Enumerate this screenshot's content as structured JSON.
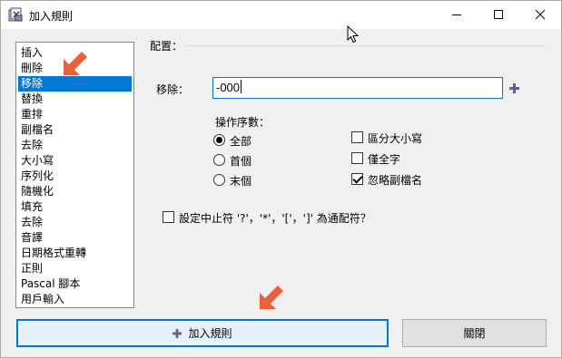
{
  "window": {
    "title": "加入規則",
    "icon": "app-settings-icon",
    "controls": [
      "minimize-icon",
      "maximize-icon",
      "close-icon"
    ]
  },
  "rules": {
    "items": [
      "插入",
      "刪除",
      "移除",
      "替換",
      "重排",
      "副檔名",
      "去除",
      "大小寫",
      "序列化",
      "隨機化",
      "填充",
      "去除",
      "音譯",
      "日期格式重轉",
      "正則",
      "Pascal 腳本",
      "用戶輸入"
    ],
    "selected_index": 2
  },
  "config": {
    "group_label": "配置：",
    "remove_label": "移除：",
    "remove_value": "-000",
    "add_mask_icon": "plus-icon",
    "occurrence_label": "操作序數：",
    "occurrences": [
      {
        "label": "全部",
        "checked": true
      },
      {
        "label": "首個",
        "checked": false
      },
      {
        "label": "末個",
        "checked": false
      }
    ],
    "options": [
      {
        "label": "區分大小寫",
        "checked": false
      },
      {
        "label": "僅全字",
        "checked": false
      },
      {
        "label": "忽略副檔名",
        "checked": true
      }
    ],
    "wildcard_label": "設定中止符 '?'，'*'，'['，']' 為通配符？",
    "wildcard_checked": false
  },
  "buttons": {
    "add_label": "加入規則",
    "close_label": "關閉"
  },
  "colors": {
    "selection": "#0078d7",
    "annotation_arrow": "#e8613a",
    "plus_icon": "#6b5b8c"
  }
}
